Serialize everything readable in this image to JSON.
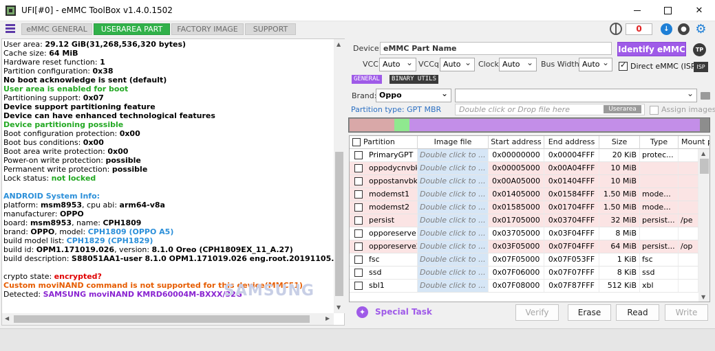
{
  "window": {
    "title": "UFI[#0] - eMMC ToolBox v1.4.0.1502"
  },
  "tabs": [
    {
      "label": "eMMC GENERAL",
      "active": false
    },
    {
      "label": "USERAREA PART",
      "active": true
    },
    {
      "label": "FACTORY IMAGE",
      "active": false
    },
    {
      "label": "SUPPORT",
      "active": false
    }
  ],
  "toolbar": {
    "counter": "0",
    "icons": [
      "globe-icon",
      "download-icon",
      "microphone-icon",
      "gear-icon"
    ]
  },
  "log_lines": [
    {
      "label": "User area: ",
      "value": "29.12 GiB(31,268,536,320 bytes)"
    },
    {
      "label": "Cache size: ",
      "value": "64 MiB"
    },
    {
      "label": "Hardware reset function: ",
      "value": "1"
    },
    {
      "label": "Partition configuration: ",
      "value": "0x38"
    },
    {
      "label": " ",
      "value": "No boot acknowledge is sent (default)"
    },
    {
      "label": " ",
      "value": "User area is enabled for boot",
      "style": "green"
    },
    {
      "label": "Partitioning support: ",
      "value": "0x07"
    },
    {
      "label": " ",
      "value": "Device support partitioning feature"
    },
    {
      "label": " ",
      "value": "Device can have enhanced technological features"
    },
    {
      "label": " ",
      "value": "Device partitioning possible",
      "style": "green"
    },
    {
      "label": "Boot configuration protection: ",
      "value": "0x00"
    },
    {
      "label": "Boot bus conditions: ",
      "value": "0x00"
    },
    {
      "label": "Boot area write protection: ",
      "value": "0x00"
    },
    {
      "label": " Power-on write protection: ",
      "value": "possible"
    },
    {
      "label": " Permanent write protection: ",
      "value": "possible"
    },
    {
      "label": " Lock status: ",
      "value": "not locked",
      "style": "green"
    },
    {
      "label": "",
      "value": ""
    },
    {
      "label": "",
      "value": "ANDROID System Info:",
      "style": "blue"
    },
    {
      "label": " platform: ",
      "value": "msm8953",
      "label2": ", cpu abi: ",
      "value2": "arm64-v8a"
    },
    {
      "label": " manufacturer: ",
      "value": "OPPO"
    },
    {
      "label": " board: ",
      "value": "msm8953",
      "label2": ", name: ",
      "value2": "CPH1809"
    },
    {
      "label": " brand: ",
      "value": "OPPO",
      "label2": ", model: ",
      "value2": "CPH1809 (OPPO A5)",
      "style2": "blue"
    },
    {
      "label": " build model list: ",
      "value": "CPH1829 (CPH1829)",
      "style": "blue"
    },
    {
      "label": " build id: ",
      "value": "OPM1.171019.026",
      "label2": ", version: ",
      "value2": "8.1.0 Oreo (CPH1809EX_11_A.27)"
    },
    {
      "label": " build description: ",
      "value": "S88051AA1-user 8.1.0 OPM1.171019.026 eng.root.20191105.001416 r"
    },
    {
      "label": "",
      "value": ""
    },
    {
      "label": "crypto state: ",
      "value": "encrypted?",
      "style": "red"
    },
    {
      "label": "",
      "value": "Custom moviNAND command is not supported for this device(MMC51).",
      "style": "orange"
    },
    {
      "label": "Detected: ",
      "value": "SAMSUNG moviNAND KMRD60004M-BXXX/32G",
      "style": "purple"
    }
  ],
  "watermark": "SAMSUNG",
  "device": {
    "label": "Device:",
    "value": "eMMC Part Name",
    "identify_label": "Identify eMMC",
    "tp_badge": "TP",
    "vcc_label": "VCC:",
    "vcc_value": "Auto",
    "vccq_label": "VCCq:",
    "vccq_value": "Auto",
    "clock_label": "Clock:",
    "clock_value": "Auto",
    "bus_label": "Bus Width:",
    "bus_value": "Auto",
    "direct_label": "Direct eMMC (ISP)",
    "isp_badge": "ISP"
  },
  "subtabs": [
    {
      "label": "GENERAL",
      "active": true
    },
    {
      "label": "BINARY UTILS",
      "active": false
    }
  ],
  "brand": {
    "label": "Brand:",
    "value": "Oppo",
    "file_value": ""
  },
  "partition_type": "Partition type: GPT MBR",
  "drop_hint": "Double click or Drop file here",
  "userarea_tag": "Userarea",
  "assign_images": "Assign images",
  "colors": {
    "accent": "#9f5be8",
    "active_tab": "#31b14a",
    "row_pink": "#fbe4e4",
    "image_cell": "#d6e6f6"
  },
  "partition_bar": [
    {
      "fraction": 0.125,
      "color": "#d9a8a8"
    },
    {
      "fraction": 0.042,
      "color": "#8fe88f"
    },
    {
      "fraction": 0.818,
      "color": "#c38ee8"
    }
  ],
  "table": {
    "headers": [
      "Partition",
      "Image file",
      "Start address",
      "End address",
      "Size",
      "Type",
      "Mount p"
    ],
    "rows": [
      {
        "name": "PrimaryGPT",
        "image": "Double click to ...",
        "start": "0x00000000",
        "end": "0x00004FFF",
        "size": "20 KiB",
        "type": "protec...",
        "mount": "",
        "pink": false
      },
      {
        "name": "oppodycnvbk",
        "image": "Double click to ...",
        "start": "0x00005000",
        "end": "0x00A04FFF",
        "size": "10 MiB",
        "type": "",
        "mount": "",
        "pink": true
      },
      {
        "name": "oppostanvbk",
        "image": "Double click to ...",
        "start": "0x00A05000",
        "end": "0x01404FFF",
        "size": "10 MiB",
        "type": "",
        "mount": "",
        "pink": true
      },
      {
        "name": "modemst1",
        "image": "Double click to ...",
        "start": "0x01405000",
        "end": "0x01584FFF",
        "size": "1.50 MiB",
        "type": "mode...",
        "mount": "",
        "pink": true
      },
      {
        "name": "modemst2",
        "image": "Double click to ...",
        "start": "0x01585000",
        "end": "0x01704FFF",
        "size": "1.50 MiB",
        "type": "mode...",
        "mount": "",
        "pink": true
      },
      {
        "name": "persist",
        "image": "Double click to ...",
        "start": "0x01705000",
        "end": "0x03704FFF",
        "size": "32 MiB",
        "type": "persist...",
        "mount": "/pe",
        "pink": true
      },
      {
        "name": "opporeserve1",
        "image": "Double click to ...",
        "start": "0x03705000",
        "end": "0x03F04FFF",
        "size": "8 MiB",
        "type": "",
        "mount": "",
        "pink": false
      },
      {
        "name": "opporeserve2",
        "image": "Double click to ...",
        "start": "0x03F05000",
        "end": "0x07F04FFF",
        "size": "64 MiB",
        "type": "persist...",
        "mount": "/op",
        "pink": true
      },
      {
        "name": "fsc",
        "image": "Double click to ...",
        "start": "0x07F05000",
        "end": "0x07F053FF",
        "size": "1 KiB",
        "type": "fsc",
        "mount": "",
        "pink": false
      },
      {
        "name": "ssd",
        "image": "Double click to ...",
        "start": "0x07F06000",
        "end": "0x07F07FFF",
        "size": "8 KiB",
        "type": "ssd",
        "mount": "",
        "pink": false
      },
      {
        "name": "sbl1",
        "image": "Double click to ...",
        "start": "0x07F08000",
        "end": "0x07F87FFF",
        "size": "512 KiB",
        "type": "xbl",
        "mount": "",
        "pink": false
      }
    ]
  },
  "special_task": "Special Task",
  "actions": [
    {
      "label": "Verify",
      "enabled": false
    },
    {
      "label": "Erase",
      "enabled": true
    },
    {
      "label": "Read",
      "enabled": true
    },
    {
      "label": "Write",
      "enabled": false
    }
  ]
}
